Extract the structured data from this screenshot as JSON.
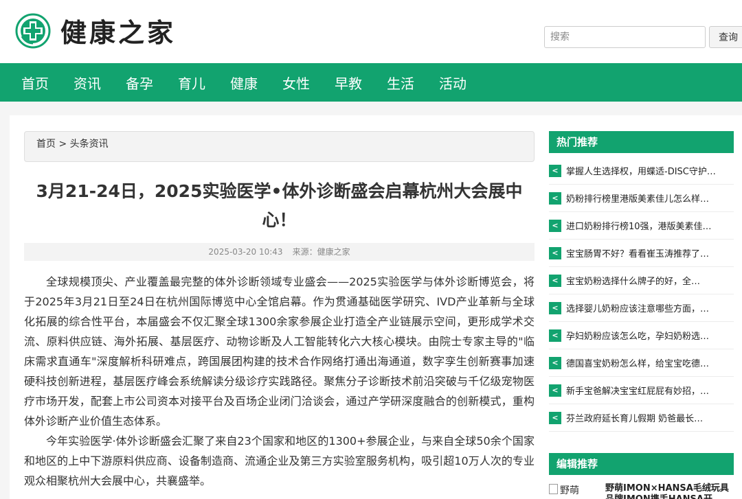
{
  "site": {
    "name": "健康之家"
  },
  "search": {
    "placeholder": "搜索",
    "button_label": "查询"
  },
  "nav": {
    "items": [
      "首页",
      "资讯",
      "备孕",
      "育儿",
      "健康",
      "女性",
      "早教",
      "生活",
      "活动"
    ]
  },
  "breadcrumb": {
    "home": "首页",
    "separator": " > ",
    "current": "头条资讯"
  },
  "article": {
    "title": "3月21-24日，2025实验医学•体外诊断盛会启幕杭州大会展中心！",
    "date": "2025-03-20 10:43",
    "source": "来源：健康之家",
    "paragraphs": [
      "全球规模顶尖、产业覆盖最完整的体外诊断领域专业盛会——2025实验医学与体外诊断博览会，将于2025年3月21日至24日在杭州国际博览中心全馆启幕。作为贯通基础医学研究、IVD产业革新与全球化拓展的综合性平台，本届盛会不仅汇聚全球1300余家参展企业打造全产业链展示空间，更形成学术交流、原料供应链、海外拓展、基层医疗、动物诊断及人工智能转化六大核心模块。由院士专家主导的\"临床需求直通车\"深度解析科研难点，跨国展团构建的技术合作网络打通出海通道，数字孪生创新赛事加速硬科技创新进程，基层医疗峰会系统解读分级诊疗实践路径。聚焦分子诊断技术前沿突破与千亿级宠物医疗市场开发，配套上市公司资本对接平台及百场企业闭门洽谈会，通过产学研深度融合的创新模式，重构体外诊断产业价值生态体系。",
      "今年实验医学·体外诊断盛会汇聚了来自23个国家和地区的1300+参展企业，与来自全球50余个国家和地区的上中下游原料供应商、设备制造商、流通企业及第三方实验室服务机构，吸引超10万人次的专业观众相聚杭州大会展中心，共襄盛举。"
    ]
  },
  "sidebar": {
    "hot_title": "热门推荐",
    "hot_items": [
      "掌握人生选择权，用蝶适-DISC守护…",
      "奶粉排行榜里港版美素佳儿怎么样…",
      "进口奶粉排行榜10强，港版美素佳…",
      "宝宝肠胃不好？看看崔玉涛推荐了…",
      "宝宝奶粉选择什么牌子的好，全…",
      "选择婴儿奶粉应该注意哪些方面，…",
      "孕妇奶粉应该怎么吃，孕妇奶粉选…",
      "德国喜宝奶粉怎么样，给宝宝吃德…",
      "新手宝爸解决宝宝红屁屁有妙招，…",
      "芬兰政府延长育儿假期 奶爸最长…"
    ],
    "editor_title": "编辑推荐",
    "editor_item": {
      "thumb_alt": "野萌",
      "title": "野萌IMON×HANSA毛绒玩具品牌IMON携手HANSA开"
    }
  },
  "colors": {
    "brand_green": "#12a36f"
  }
}
